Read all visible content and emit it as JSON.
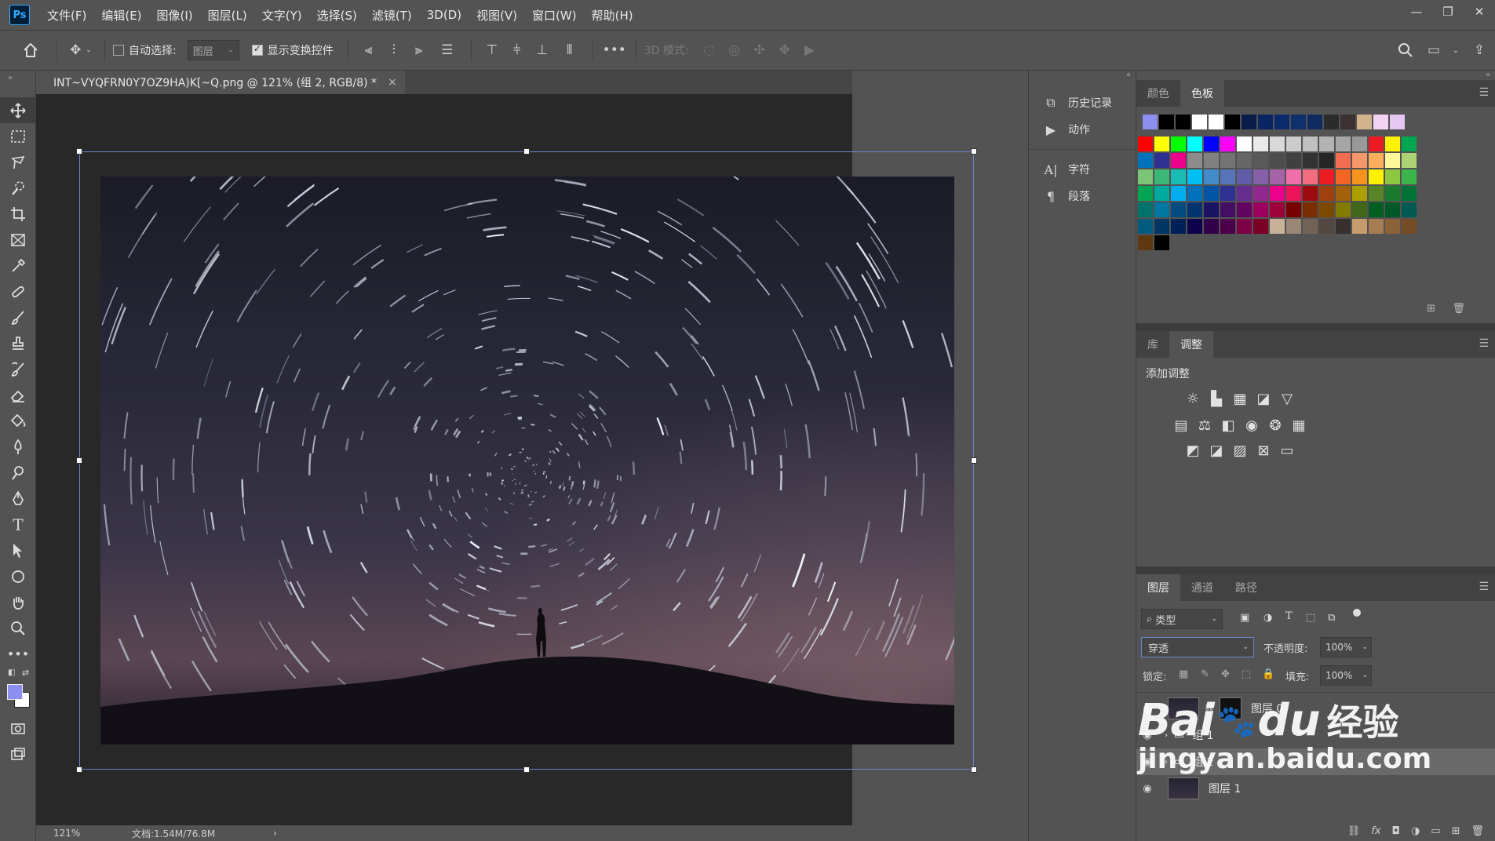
{
  "menubar": {
    "app_logo": "Ps",
    "items": [
      "文件(F)",
      "编辑(E)",
      "图像(I)",
      "图层(L)",
      "文字(Y)",
      "选择(S)",
      "滤镜(T)",
      "3D(D)",
      "视图(V)",
      "窗口(W)",
      "帮助(H)"
    ],
    "window_buttons": [
      "—",
      "❐",
      "✕"
    ]
  },
  "options": {
    "auto_select_label": "自动选择:",
    "auto_select_value": "图层",
    "show_transform_label": "显示变换控件",
    "mode_3d_label": "3D 模式:",
    "more": "•••"
  },
  "document": {
    "tab_title": "INT~VYQFRN0Y7OZ9HA)K[~Q.png @ 121% (组 2, RGB/8) *",
    "close": "×"
  },
  "status": {
    "zoom": "121%",
    "doc_size": "文档:1.54M/76.8M",
    "arrow": "›"
  },
  "mid_panel": {
    "items": [
      {
        "icon": "history-icon",
        "label": "历史记录"
      },
      {
        "icon": "play-icon",
        "label": "动作"
      },
      {
        "icon": "character-icon",
        "label": "字符"
      },
      {
        "icon": "paragraph-icon",
        "label": "段落"
      }
    ]
  },
  "swatches_panel": {
    "tabs": [
      "颜色",
      "色板"
    ],
    "active_tab": "色板",
    "recent": [
      "#8c8ff0",
      "#000000",
      "#000000",
      "#ffffff",
      "#ffffff",
      "#000000",
      "#0a1d4a",
      "#0b2463",
      "#0b2a6b",
      "#10306b",
      "#0f2a5f",
      "#2b2b2b",
      "#3a3130",
      "#d2b48c",
      "#f3d3f3",
      "#e6c6f3"
    ],
    "grid": [
      [
        "#ff0000",
        "#ffff00",
        "#00ff00",
        "#00ffff",
        "#0000ff",
        "#ff00ff",
        "#ffffff",
        "#eaeaea",
        "#d9d9d9",
        "#cccccc",
        "#c0c0c0",
        "#b3b3b3",
        "#a6a6a6",
        "#999999",
        "#ed1c24",
        "#fff200",
        "#00a651"
      ],
      [
        "#0072bc",
        "#2e3192",
        "#ec008c",
        "#8c8c8c",
        "#808080",
        "#737373",
        "#666666",
        "#595959",
        "#4d4d4d",
        "#404040",
        "#333333",
        "#262626",
        "#f26c4f",
        "#f7976a",
        "#fbaf5d",
        "#fff799",
        "#acd373"
      ],
      [
        "#7cc576",
        "#3bb878",
        "#1abbb4",
        "#00bff3",
        "#438ccb",
        "#5574b9",
        "#605ca8",
        "#855fa8",
        "#a763a9",
        "#f06eaa",
        "#f26d7d",
        "#ed1c24",
        "#f26522",
        "#f7941d",
        "#fff200",
        "#8dc63f",
        "#39b54a"
      ],
      [
        "#00a651",
        "#00a99d",
        "#00aeef",
        "#0072bc",
        "#0054a6",
        "#2e3192",
        "#662d91",
        "#92278f",
        "#ec008c",
        "#ed145b",
        "#9e0b0f",
        "#a0410d",
        "#a3620a",
        "#aba000",
        "#598527",
        "#1a7b30",
        "#007236"
      ],
      [
        "#00746b",
        "#0076a3",
        "#004b80",
        "#003471",
        "#1b1464",
        "#440e62",
        "#630460",
        "#9e005d",
        "#9e0039",
        "#790000",
        "#7b2e00",
        "#7d4900",
        "#827b00",
        "#406618",
        "#005e20",
        "#005826",
        "#005952"
      ],
      [
        "#005b7f",
        "#003663",
        "#002157",
        "#0d004c",
        "#32004b",
        "#4b0049",
        "#7b0046",
        "#7a0026",
        "#c7b299",
        "#998675",
        "#736357",
        "#534741",
        "#37302d",
        "#c69c6d",
        "#a67c52",
        "#8c6239",
        "#754c24"
      ],
      [
        "#603913",
        "#000000"
      ]
    ]
  },
  "adjust_panel": {
    "tabs": [
      "库",
      "调整"
    ],
    "active_tab": "调整",
    "add_label": "添加调整"
  },
  "layers_panel": {
    "tabs": [
      "图层",
      "通道",
      "路径"
    ],
    "active_tab": "图层",
    "filter_label": "类型",
    "blend_mode": "穿透",
    "opacity_label": "不透明度:",
    "opacity_value": "100%",
    "lock_label": "锁定:",
    "fill_label": "填充:",
    "fill_value": "100%",
    "layers": [
      {
        "name": "图层 0",
        "kind": "layer"
      },
      {
        "name": "组 1",
        "kind": "group"
      },
      {
        "name": "组 2",
        "kind": "group"
      },
      {
        "name": "图层 1",
        "kind": "layer"
      }
    ]
  },
  "watermark": {
    "brand": "Bai",
    "brand2": "du",
    "cn": "经验",
    "url": "jingyan.baidu.com"
  }
}
